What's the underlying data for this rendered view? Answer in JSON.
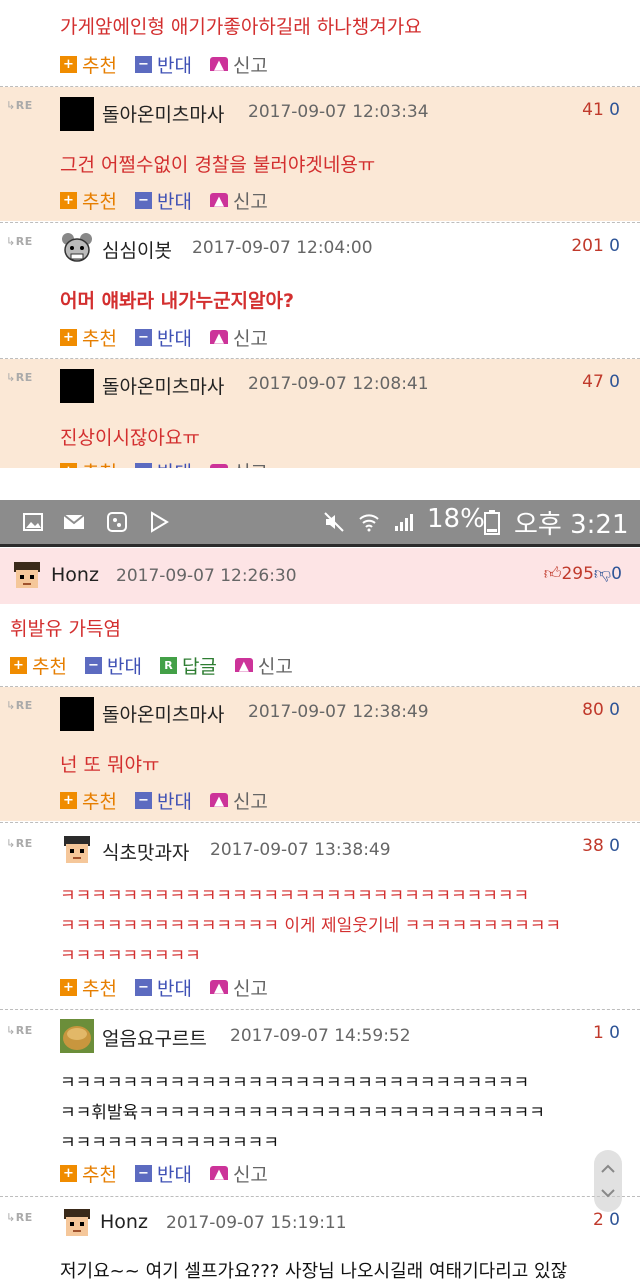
{
  "labels": {
    "recommend": "추천",
    "oppose": "반대",
    "report": "신고",
    "reply": "답글",
    "re": "RE"
  },
  "icons": {
    "recommend": "plus-square-icon",
    "oppose": "minus-square-icon",
    "report": "siren-icon",
    "reply": "r-square-icon",
    "thumbs_up": "thumbs-up-icon",
    "thumbs_down": "thumbs-down-icon"
  },
  "colors": {
    "accent_red": "#d32f2f",
    "reply_bg": "#fbe8d6",
    "post_bg": "#fde4e5",
    "recommend": "#f08c00",
    "oppose": "#5c6bc0"
  },
  "top": {
    "partial_text": "가게앞에인형 애기가좋아하길래 하나챙겨가요",
    "comments": [
      {
        "user": "돌아온미츠마사",
        "time": "2017-09-07 12:03:34",
        "up": "41",
        "down": "0",
        "text": "그건 어쩔수없이 경찰을 불러야겟네용ㅠ"
      },
      {
        "user": "심심이봇",
        "time": "2017-09-07 12:04:00",
        "up": "201",
        "down": "0",
        "text": "어머 얘봐라 내가누군지알아?"
      },
      {
        "user": "돌아온미츠마사",
        "time": "2017-09-07 12:08:41",
        "up": "47",
        "down": "0",
        "text": "진상이시잖아요ㅠ"
      }
    ]
  },
  "statusbar": {
    "battery": "18%",
    "time": "오후 3:21"
  },
  "post": {
    "user": "Honz",
    "time": "2017-09-07 12:26:30",
    "up": "295",
    "down": "0",
    "text": "휘발유 가득염"
  },
  "replies": [
    {
      "user": "돌아온미츠마사",
      "time": "2017-09-07 12:38:49",
      "up": "80",
      "down": "0",
      "text": "넌 또 뭐야ㅠ"
    },
    {
      "user": "식초맛과자",
      "time": "2017-09-07 13:38:49",
      "up": "38",
      "down": "0",
      "line1": "ㅋㅋㅋㅋㅋㅋㅋㅋㅋㅋㅋㅋㅋㅋㅋㅋㅋㅋㅋㅋㅋㅋㅋㅋㅋㅋㅋㅋㅋㅋ",
      "line2": "ㅋㅋㅋㅋㅋㅋㅋㅋㅋㅋㅋㅋㅋㅋ 이게 제일웃기네 ㅋㅋㅋㅋㅋㅋㅋㅋㅋㅋ",
      "line3": "ㅋㅋㅋㅋㅋㅋㅋㅋㅋ"
    },
    {
      "user": "얼음요구르트",
      "time": "2017-09-07 14:59:52",
      "up": "1",
      "down": "0",
      "line1": "ㅋㅋㅋㅋㅋㅋㅋㅋㅋㅋㅋㅋㅋㅋㅋㅋㅋㅋㅋㅋㅋㅋㅋㅋㅋㅋㅋㅋㅋㅋ",
      "line2": "ㅋㅋ휘발육ㅋㅋㅋㅋㅋㅋㅋㅋㅋㅋㅋㅋㅋㅋㅋㅋㅋㅋㅋㅋㅋㅋㅋㅋㅋㅋ",
      "line3": "ㅋㅋㅋㅋㅋㅋㅋㅋㅋㅋㅋㅋㅋㅋ"
    },
    {
      "user": "Honz",
      "time": "2017-09-07 15:19:11",
      "up": "2",
      "down": "0",
      "text": "저기요~~ 여기 셀프가요??? 사장님 나오시길래 여태기다리고 있잖"
    }
  ]
}
